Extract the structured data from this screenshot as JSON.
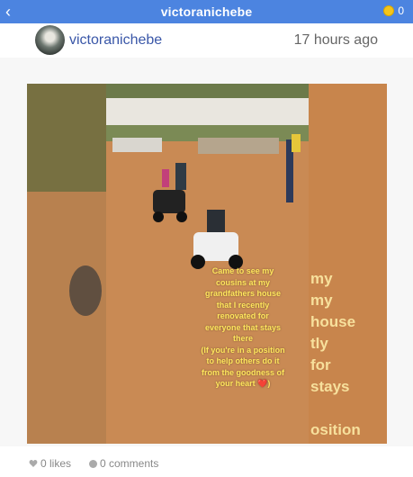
{
  "topbar": {
    "title": "victoranichebe",
    "back_icon": "chevron-left-icon",
    "coin_count": "0"
  },
  "post": {
    "username": "victoranichebe",
    "time": "17 hours ago",
    "caption_lines": [
      "Came to see my",
      "cousins at my",
      "grandfathers house",
      "that I recently",
      "renovated for",
      "everyone that stays",
      "there",
      "(If you're in a position",
      "to help others do it",
      "from the goodness of",
      "your heart ❤️)"
    ],
    "bg_caption_lines": [
      "my",
      "my",
      "house",
      "tly",
      "for",
      "stays",
      "",
      "osition"
    ],
    "likes": "0 likes",
    "comments": "0 comments"
  },
  "colors": {
    "accent": "#4c84e0",
    "username": "#3a57a8",
    "caption": "#ffe65c"
  }
}
